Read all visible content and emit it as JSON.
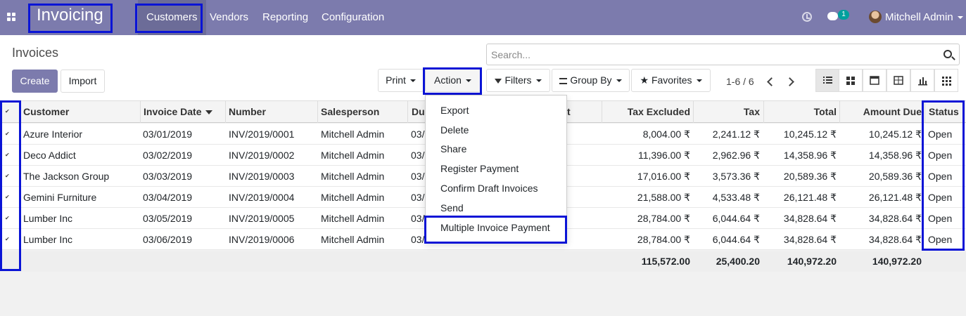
{
  "topbar": {
    "brand": "Invoicing",
    "nav": [
      "Customers",
      "Vendors",
      "Reporting",
      "Configuration"
    ],
    "chat_badge": "1",
    "user": "Mitchell Admin"
  },
  "control_panel": {
    "breadcrumb": "Invoices",
    "search_placeholder": "Search...",
    "create_label": "Create",
    "import_label": "Import",
    "print_label": "Print",
    "action_label": "Action",
    "filters_label": "Filters",
    "groupby_label": "Group By",
    "favorites_label": "Favorites",
    "pager": "1-6 / 6"
  },
  "action_menu": [
    "Export",
    "Delete",
    "Share",
    "Register Payment",
    "Confirm Draft Invoices",
    "Send",
    "Multiple Invoice Payment"
  ],
  "table": {
    "headers": {
      "customer": "Customer",
      "invoice_date": "Invoice Date",
      "number": "Number",
      "salesperson": "Salesperson",
      "due": "Du",
      "hidden_tail": "t",
      "tax_excluded": "Tax Excluded",
      "tax": "Tax",
      "total": "Total",
      "amount_due": "Amount Due",
      "status": "Status"
    },
    "rows": [
      {
        "customer": "Azure Interior",
        "date": "03/01/2019",
        "number": "INV/2019/0001",
        "salesperson": "Mitchell Admin",
        "due": "03/",
        "tax_excluded": "8,004.00 ₹",
        "tax": "2,241.12 ₹",
        "total": "10,245.12 ₹",
        "amount_due": "10,245.12 ₹",
        "status": "Open"
      },
      {
        "customer": "Deco Addict",
        "date": "03/02/2019",
        "number": "INV/2019/0002",
        "salesperson": "Mitchell Admin",
        "due": "03/",
        "tax_excluded": "11,396.00 ₹",
        "tax": "2,962.96 ₹",
        "total": "14,358.96 ₹",
        "amount_due": "14,358.96 ₹",
        "status": "Open"
      },
      {
        "customer": "The Jackson Group",
        "date": "03/03/2019",
        "number": "INV/2019/0003",
        "salesperson": "Mitchell Admin",
        "due": "03/",
        "tax_excluded": "17,016.00 ₹",
        "tax": "3,573.36 ₹",
        "total": "20,589.36 ₹",
        "amount_due": "20,589.36 ₹",
        "status": "Open"
      },
      {
        "customer": "Gemini Furniture",
        "date": "03/04/2019",
        "number": "INV/2019/0004",
        "salesperson": "Mitchell Admin",
        "due": "03/",
        "tax_excluded": "21,588.00 ₹",
        "tax": "4,533.48 ₹",
        "total": "26,121.48 ₹",
        "amount_due": "26,121.48 ₹",
        "status": "Open"
      },
      {
        "customer": "Lumber Inc",
        "date": "03/05/2019",
        "number": "INV/2019/0005",
        "salesperson": "Mitchell Admin",
        "due": "03/",
        "tax_excluded": "28,784.00 ₹",
        "tax": "6,044.64 ₹",
        "total": "34,828.64 ₹",
        "amount_due": "34,828.64 ₹",
        "status": "Open"
      },
      {
        "customer": "Lumber Inc",
        "date": "03/06/2019",
        "number": "INV/2019/0006",
        "salesperson": "Mitchell Admin",
        "due": "03/",
        "tax_excluded": "28,784.00 ₹",
        "tax": "6,044.64 ₹",
        "total": "34,828.64 ₹",
        "amount_due": "34,828.64 ₹",
        "status": "Open"
      }
    ],
    "totals": {
      "tax_excluded": "115,572.00",
      "tax": "25,400.20",
      "total": "140,972.20",
      "amount_due": "140,972.20"
    }
  },
  "colors": {
    "brand": "#7c7bad",
    "highlight": "#0a14d6"
  }
}
